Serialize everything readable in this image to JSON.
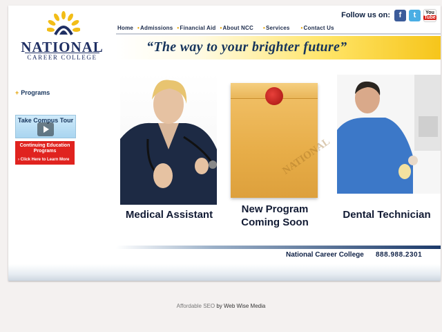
{
  "logo": {
    "name": "NATIONAL",
    "subtitle": "CAREER COLLEGE"
  },
  "social": {
    "label": "Follow us on:",
    "facebook_glyph": "f",
    "twitter_glyph": "t",
    "youtube_you": "You",
    "youtube_tube": "Tube"
  },
  "nav": [
    {
      "label": "Home"
    },
    {
      "label": "Admissions"
    },
    {
      "label": "Financial Aid"
    },
    {
      "label": "About NCC"
    },
    {
      "label": "Services"
    },
    {
      "label": "Contact Us"
    }
  ],
  "tagline": "“The way to your brighter future”",
  "sidebar": {
    "programs": "Programs",
    "tour_label": "Take Compus Tour",
    "ce_line1": "Continuing Education",
    "ce_line2": "Programs",
    "ce_cta": "Click Here to Learn More"
  },
  "programs": {
    "medical": "Medical Assistant",
    "new_line1": "New Program",
    "new_line2": "Coming Soon",
    "dental": "Dental Technician",
    "envelope_watermark": "NATIONAL"
  },
  "footer": {
    "name": "National Career College",
    "phone": "888.988.2301",
    "credit_prefix": "Affordable SEO",
    "credit_suffix": " by Web Wise Media"
  },
  "colors": {
    "accent": "#e2a000",
    "navy": "#1f2f63"
  }
}
